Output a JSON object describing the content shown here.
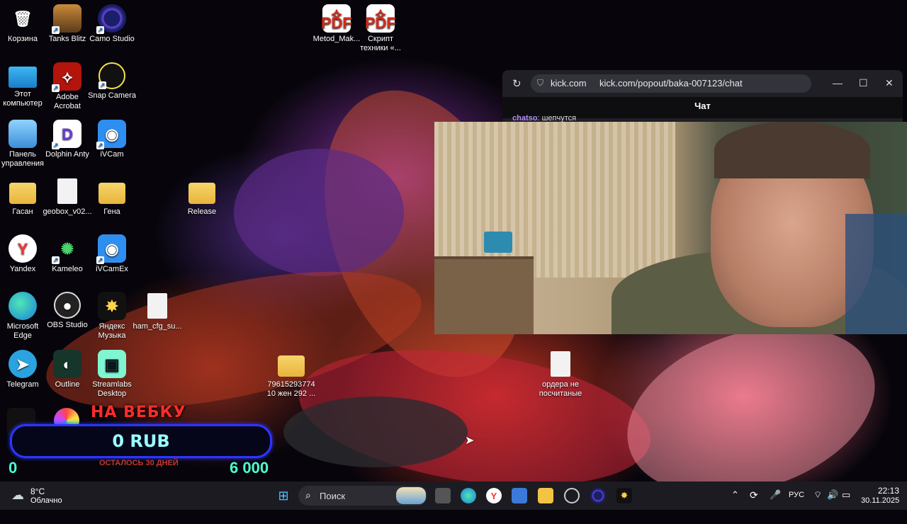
{
  "desktop": {
    "icons": [
      {
        "label": "Корзина",
        "icon": "recycle-bin-icon"
      },
      {
        "label": "Tanks Blitz",
        "icon": "tanks-blitz-icon"
      },
      {
        "label": "Camo Studio",
        "icon": "camo-studio-icon"
      },
      {
        "label": "Metod_Mak...",
        "icon": "pdf-file-icon"
      },
      {
        "label": "Скрипт техники «...",
        "icon": "pdf-file-icon"
      },
      {
        "label": "Этот компьютер",
        "icon": "computer-icon"
      },
      {
        "label": "Adobe Acrobat",
        "icon": "acrobat-icon"
      },
      {
        "label": "Snap Camera",
        "icon": "snap-camera-icon"
      },
      {
        "label": "Панель управления",
        "icon": "control-panel-icon"
      },
      {
        "label": "Dolphin Anty",
        "icon": "dolphin-anty-icon"
      },
      {
        "label": "iVCam",
        "icon": "ivcam-icon"
      },
      {
        "label": "Гасан",
        "icon": "folder-icon"
      },
      {
        "label": "geobox_v02...",
        "icon": "file-icon"
      },
      {
        "label": "Гена",
        "icon": "folder-icon"
      },
      {
        "label": "Release",
        "icon": "folder-icon"
      },
      {
        "label": "Yandex",
        "icon": "yandex-browser-icon"
      },
      {
        "label": "Kameleo",
        "icon": "kameleo-icon"
      },
      {
        "label": "iVCamEx",
        "icon": "ivcam-icon"
      },
      {
        "label": "Microsoft Edge",
        "icon": "edge-icon"
      },
      {
        "label": "OBS Studio",
        "icon": "obs-icon"
      },
      {
        "label": "Яндекс Музыка",
        "icon": "yandex-music-icon"
      },
      {
        "label": "ham_cfg_su...",
        "icon": "file-icon"
      },
      {
        "label": "Telegram",
        "icon": "telegram-icon"
      },
      {
        "label": "Outline",
        "icon": "outline-icon"
      },
      {
        "label": "Streamlabs Desktop",
        "icon": "streamlabs-icon"
      },
      {
        "label": "79615293774 10 жен 292 ...",
        "icon": "folder-icon"
      },
      {
        "label": "ордера не посчитаные",
        "icon": "file-icon"
      }
    ]
  },
  "browser": {
    "site": "kick.com",
    "url": "kick.com/popout/baka-007123/chat",
    "chat_title": "Чат",
    "chat_line_user": "chatso",
    "chat_line_text": ": шепчутся"
  },
  "donation": {
    "title": "НА ВЕБКУ",
    "amount": "0 RUB",
    "min": "0",
    "max": "6 000",
    "subtitle": "ОСТАЛОСЬ 30 ДНЕЙ"
  },
  "taskbar": {
    "weather_temp": "8°C",
    "weather_desc": "Облачно",
    "search_placeholder": "Поиск",
    "lang": "РУС",
    "time": "22:13",
    "date": "30.11.2025"
  }
}
